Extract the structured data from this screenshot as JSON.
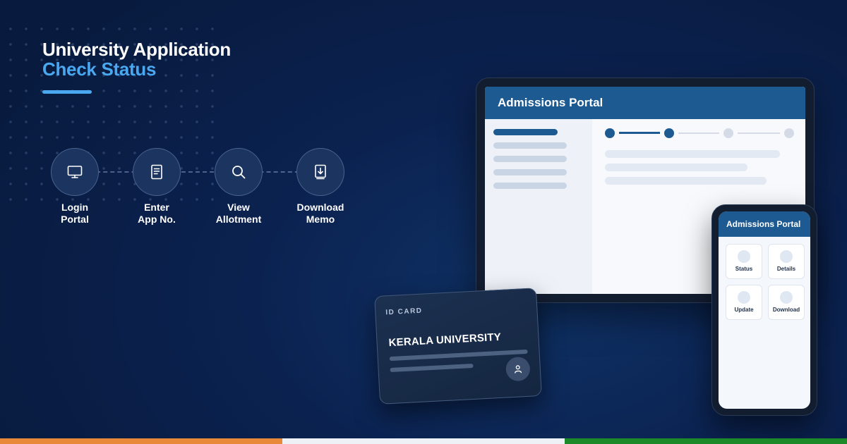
{
  "headline": {
    "line1": "University Application",
    "line2": "Check Status"
  },
  "colors": {
    "accent": "#4aa8f0",
    "portal_blue": "#1d5a91",
    "stripe": [
      "#e8893a",
      "#eef1f5",
      "#1d8a2a"
    ]
  },
  "steps": [
    {
      "icon": "monitor-icon",
      "line1": "Login",
      "line2": "Portal"
    },
    {
      "icon": "document-icon",
      "line1": "Enter",
      "line2": "App No."
    },
    {
      "icon": "search-icon",
      "line1": "View",
      "line2": "Allotment"
    },
    {
      "icon": "download-icon",
      "line1": "Download",
      "line2": "Memo"
    }
  ],
  "tablet": {
    "title": "Admissions Portal"
  },
  "phone": {
    "title": "Admissions Portal",
    "tiles": [
      "Status",
      "Details",
      "Update",
      "Download"
    ]
  },
  "id_card": {
    "tag": "ID CARD",
    "university": "KERALA UNIVERSITY"
  }
}
